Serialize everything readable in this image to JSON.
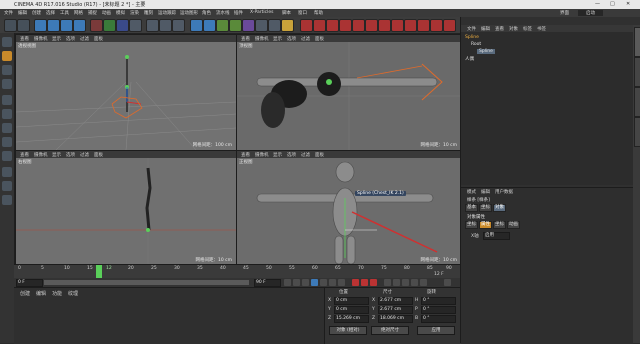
{
  "titlebar": {
    "title": "CINEMA 4D R17.016 Studio (R17) - [未标题 2 *] - 主要"
  },
  "menubar": {
    "items": [
      "文件",
      "编辑",
      "创建",
      "选择",
      "工具",
      "网格",
      "捕捉",
      "动画",
      "模拟",
      "渲染",
      "雕刻",
      "运动跟踪",
      "运动图形",
      "角色",
      "流水线",
      "插件",
      "X-Particles",
      "脚本",
      "窗口",
      "帮助"
    ],
    "layout_label": "界面",
    "layout_value": "启动"
  },
  "viewports": [
    {
      "menu": [
        "查看",
        "摄像机",
        "显示",
        "选项",
        "过滤",
        "面板"
      ],
      "label": "透视视图",
      "footer": "网格间距：100 cm"
    },
    {
      "menu": [
        "查看",
        "摄像机",
        "显示",
        "选项",
        "过滤",
        "面板"
      ],
      "label": "顶视图",
      "footer": "网格间距：10 cm"
    },
    {
      "menu": [
        "查看",
        "摄像机",
        "显示",
        "选项",
        "过滤",
        "面板"
      ],
      "label": "右视图",
      "footer": "网格间距：10 cm"
    },
    {
      "menu": [
        "查看",
        "摄像机",
        "显示",
        "选项",
        "过滤",
        "面板"
      ],
      "label": "正视图",
      "footer": "网格间距：10 cm"
    }
  ],
  "tooltip": "Spline (Chest_IK 2.1)",
  "timeline": {
    "ticks": [
      "0",
      "5",
      "10",
      "15",
      "20",
      "25",
      "30",
      "35",
      "40",
      "45",
      "50",
      "55",
      "60",
      "65",
      "70",
      "75",
      "80",
      "85",
      "90"
    ],
    "current": "12",
    "end": "12 F",
    "start_field": "0 F",
    "end_field": "90 F"
  },
  "bottom_left": {
    "menu": [
      "创建",
      "编辑",
      "功能",
      "纹理"
    ]
  },
  "coords": {
    "headers": [
      "位置",
      "尺寸",
      "旋转"
    ],
    "rows": [
      {
        "axis": "X",
        "pos": "0 cm",
        "size": "2.677 cm",
        "rot_label": "H",
        "rot": "0 °"
      },
      {
        "axis": "Y",
        "pos": "0 cm",
        "size": "2.677 cm",
        "rot_label": "P",
        "rot": "0 °"
      },
      {
        "axis": "Z",
        "pos": "15.269 cm",
        "size": "18.069 cm",
        "rot_label": "B",
        "rot": "0 °"
      }
    ],
    "mode_left": "对象 (相对)",
    "mode_mid": "绝对尺寸",
    "apply": "应用"
  },
  "right_panel": {
    "top_tabs": [
      "文件",
      "编辑",
      "查看",
      "对象",
      "标签",
      "书签"
    ],
    "objects": [
      "Spline",
      "Root",
      "Spline",
      "人偶"
    ],
    "attr_tabs": [
      "模式",
      "编辑",
      "用户数据"
    ],
    "attr_title": "样条 [样条]",
    "attr_tabs2": [
      "基本",
      "坐标",
      "对象"
    ],
    "section": "对象属性",
    "attr_tabs3": [
      "坐标",
      "属性",
      "坐标",
      "动画"
    ],
    "field_label": "X轴",
    "field_value": "启用"
  },
  "colors": {
    "accent": "#c98a2a",
    "selection": "#5a6b7e",
    "viewport_bg": "#6e6e6e"
  }
}
